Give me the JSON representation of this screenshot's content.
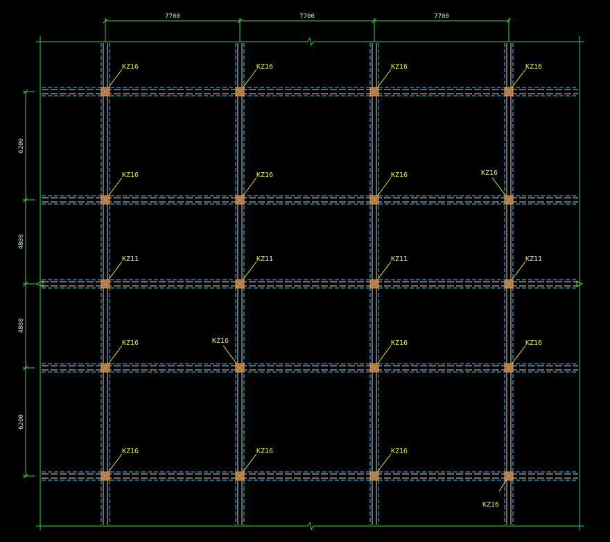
{
  "colors": {
    "background": "#000000",
    "boundary_line": "#3fd23f",
    "dimension_line": "#3fd23f",
    "beam_solid": "#d8d8d8",
    "beam_dashed": "#3ec6ff",
    "column_fill": "#a57a4f",
    "column_edge": "#ff9a2e",
    "label_text": "#e8e84a",
    "leader_line": "#e8e84a"
  },
  "dimensions": {
    "top": [
      "7700",
      "7700",
      "7700"
    ],
    "left": [
      "6200",
      "4800",
      "4800",
      "6200"
    ]
  },
  "columns": [
    {
      "row": 0,
      "col": 0,
      "label": "KZ16"
    },
    {
      "row": 0,
      "col": 1,
      "label": "KZ16"
    },
    {
      "row": 0,
      "col": 2,
      "label": "KZ16"
    },
    {
      "row": 0,
      "col": 3,
      "label": "KZ16"
    },
    {
      "row": 1,
      "col": 0,
      "label": "KZ16"
    },
    {
      "row": 1,
      "col": 1,
      "label": "KZ16"
    },
    {
      "row": 1,
      "col": 2,
      "label": "KZ16"
    },
    {
      "row": 1,
      "col": 3,
      "label": "KZ16"
    },
    {
      "row": 2,
      "col": 0,
      "label": "KZ11"
    },
    {
      "row": 2,
      "col": 1,
      "label": "KZ11"
    },
    {
      "row": 2,
      "col": 2,
      "label": "KZ11"
    },
    {
      "row": 2,
      "col": 3,
      "label": "KZ11"
    },
    {
      "row": 3,
      "col": 0,
      "label": "KZ16"
    },
    {
      "row": 3,
      "col": 1,
      "label": "KZ16"
    },
    {
      "row": 3,
      "col": 2,
      "label": "KZ16"
    },
    {
      "row": 3,
      "col": 3,
      "label": "KZ16"
    },
    {
      "row": 4,
      "col": 0,
      "label": "KZ16"
    },
    {
      "row": 4,
      "col": 1,
      "label": "KZ16"
    },
    {
      "row": 4,
      "col": 2,
      "label": "KZ16"
    },
    {
      "row": 4,
      "col": 3,
      "label": "KZ16"
    }
  ]
}
